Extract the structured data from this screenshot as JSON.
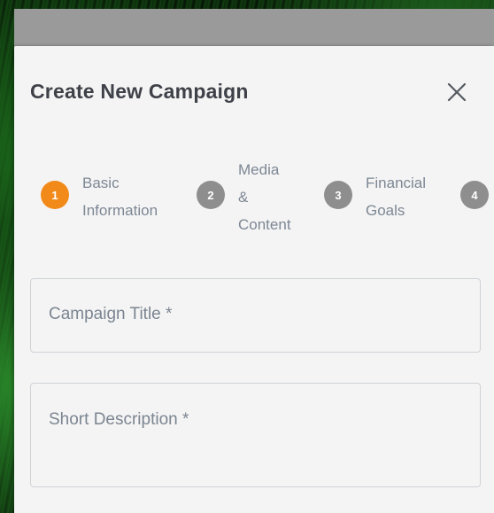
{
  "modal": {
    "title": "Create New Campaign",
    "close_icon": "close-icon"
  },
  "steps": [
    {
      "number": "1",
      "label_line1": "Basic",
      "label_line2": "Information",
      "label_line3": "",
      "state": "active"
    },
    {
      "number": "2",
      "label_line1": "Media",
      "label_line2": "&",
      "label_line3": "Content",
      "state": "inactive"
    },
    {
      "number": "3",
      "label_line1": "Financial",
      "label_line2": "Goals",
      "label_line3": "",
      "state": "inactive"
    },
    {
      "number": "4",
      "label_line1": "",
      "label_line2": "",
      "label_line3": "",
      "state": "inactive"
    }
  ],
  "form": {
    "campaign_title_placeholder": "Campaign Title *",
    "campaign_title_value": "",
    "short_description_placeholder": "Short Description *",
    "short_description_value": ""
  },
  "colors": {
    "active_step": "#f28a1a",
    "inactive_step": "#8e8e8e",
    "modal_bg": "#f4f4f4",
    "title_text": "#3e4148",
    "muted_text": "#7d8794"
  }
}
